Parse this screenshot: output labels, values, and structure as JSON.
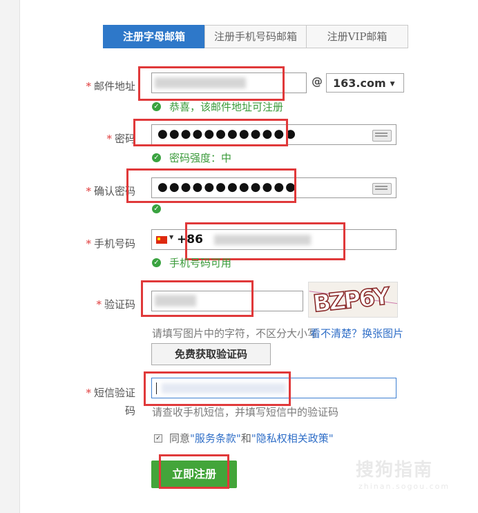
{
  "tabs": [
    {
      "label": "注册字母邮箱",
      "active": true
    },
    {
      "label": "注册手机号码邮箱",
      "active": false
    },
    {
      "label": "注册VIP邮箱",
      "active": false
    }
  ],
  "required_mark": "*",
  "email": {
    "label": "邮件地址",
    "at": "@",
    "domain": "163.com",
    "hint": "恭喜，该邮件地址可注册"
  },
  "password": {
    "label": "密码",
    "value": "●●●●●●●●●●●●",
    "hint": "密码强度：中"
  },
  "confirm_password": {
    "label": "确认密码",
    "value": "●●●●●●●●●●●●"
  },
  "phone": {
    "label": "手机号码",
    "prefix": "+86",
    "hint": "手机号码可用"
  },
  "captcha": {
    "label": "验证码",
    "image_text": "BZP6Y",
    "note": "请填写图片中的字符，不区分大小写",
    "refresh_link": "看不清楚？换张图片",
    "free_button": "免费获取验证码"
  },
  "sms": {
    "label_line1": "短信验证",
    "label_line2": "码",
    "note": "请查收手机短信，并填写短信中的验证码"
  },
  "agreement": {
    "prefix": "同意",
    "terms": "\"服务条款\"",
    "and": "和",
    "privacy": "\"隐私权相关政策\"",
    "checked": true
  },
  "submit_label": "立即注册",
  "watermark": {
    "main": "搜狗指南",
    "sub": "zhinan.sogou.com"
  },
  "colors": {
    "tab_active": "#2e78c9",
    "success": "#3a9a3a",
    "submit": "#43a53a",
    "annotation_red": "#e0393a",
    "link": "#2f6ec7"
  }
}
